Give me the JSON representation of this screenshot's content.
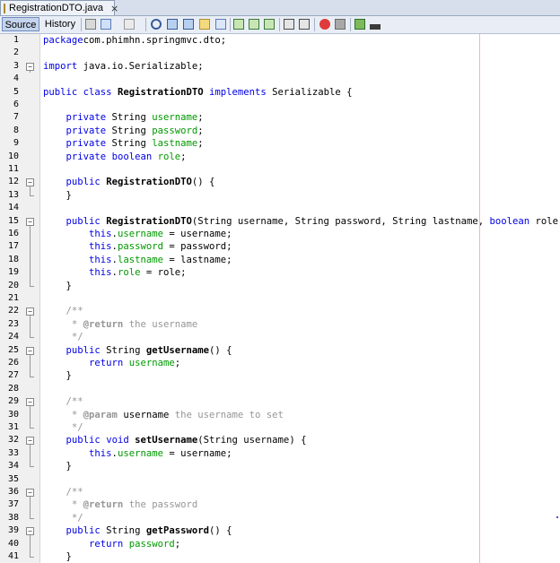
{
  "file_tab": {
    "name": "RegistrationDTO.java",
    "close": "×"
  },
  "toolbar": {
    "source_label": "Source",
    "history_label": "History"
  },
  "colors": {
    "keyword": "#0000e6",
    "field": "#009900",
    "comment": "#969696",
    "margin_line": "#f5b3c8"
  },
  "lines": [
    {
      "n": "1",
      "tokens": [
        [
          "kw",
          "package"
        ],
        [
          "",
          "com.phimhn.springmvc.dto;"
        ]
      ]
    },
    {
      "n": "2",
      "tokens": []
    },
    {
      "n": "3",
      "fold": "minus",
      "tokens": [
        [
          "kw",
          "import"
        ],
        [
          "",
          " java.io.Serializable;"
        ]
      ]
    },
    {
      "n": "4",
      "tokens": []
    },
    {
      "n": "5",
      "tokens": [
        [
          "kw",
          "public"
        ],
        [
          "",
          " "
        ],
        [
          "kw",
          "class"
        ],
        [
          "",
          " "
        ],
        [
          "bold",
          "RegistrationDTO"
        ],
        [
          "",
          " "
        ],
        [
          "kw",
          "implements"
        ],
        [
          "",
          " Serializable {"
        ]
      ]
    },
    {
      "n": "6",
      "tokens": []
    },
    {
      "n": "7",
      "tokens": [
        [
          "",
          "    "
        ],
        [
          "kw",
          "private"
        ],
        [
          "",
          " String "
        ],
        [
          "fld",
          "username"
        ],
        [
          "",
          ";"
        ]
      ]
    },
    {
      "n": "8",
      "tokens": [
        [
          "",
          "    "
        ],
        [
          "kw",
          "private"
        ],
        [
          "",
          " String "
        ],
        [
          "fld",
          "password"
        ],
        [
          "",
          ";"
        ]
      ]
    },
    {
      "n": "9",
      "tokens": [
        [
          "",
          "    "
        ],
        [
          "kw",
          "private"
        ],
        [
          "",
          " String "
        ],
        [
          "fld",
          "lastname"
        ],
        [
          "",
          ";"
        ]
      ]
    },
    {
      "n": "10",
      "tokens": [
        [
          "",
          "    "
        ],
        [
          "kw",
          "private"
        ],
        [
          "",
          " "
        ],
        [
          "kw",
          "boolean"
        ],
        [
          "",
          " "
        ],
        [
          "fld",
          "role"
        ],
        [
          "",
          ";"
        ]
      ]
    },
    {
      "n": "11",
      "tokens": []
    },
    {
      "n": "12",
      "fold": "minus",
      "tokens": [
        [
          "",
          "    "
        ],
        [
          "kw",
          "public"
        ],
        [
          "",
          " "
        ],
        [
          "bold",
          "RegistrationDTO"
        ],
        [
          "",
          "() {"
        ]
      ]
    },
    {
      "n": "13",
      "fold": "end",
      "tokens": [
        [
          "",
          "    }"
        ]
      ]
    },
    {
      "n": "14",
      "tokens": []
    },
    {
      "n": "15",
      "fold": "minus",
      "tokens": [
        [
          "",
          "    "
        ],
        [
          "kw",
          "public"
        ],
        [
          "",
          " "
        ],
        [
          "bold",
          "RegistrationDTO"
        ],
        [
          "",
          "(String username, String password, String lastname, "
        ],
        [
          "kw",
          "boolean"
        ],
        [
          "",
          " role) {"
        ]
      ]
    },
    {
      "n": "16",
      "fold": "line",
      "tokens": [
        [
          "",
          "        "
        ],
        [
          "kw",
          "this"
        ],
        [
          "",
          "."
        ],
        [
          "fld",
          "username"
        ],
        [
          "",
          " = username;"
        ]
      ]
    },
    {
      "n": "17",
      "fold": "line",
      "tokens": [
        [
          "",
          "        "
        ],
        [
          "kw",
          "this"
        ],
        [
          "",
          "."
        ],
        [
          "fld",
          "password"
        ],
        [
          "",
          " = password;"
        ]
      ]
    },
    {
      "n": "18",
      "fold": "line",
      "tokens": [
        [
          "",
          "        "
        ],
        [
          "kw",
          "this"
        ],
        [
          "",
          "."
        ],
        [
          "fld",
          "lastname"
        ],
        [
          "",
          " = lastname;"
        ]
      ]
    },
    {
      "n": "19",
      "fold": "line",
      "tokens": [
        [
          "",
          "        "
        ],
        [
          "kw",
          "this"
        ],
        [
          "",
          "."
        ],
        [
          "fld",
          "role"
        ],
        [
          "",
          " = role;"
        ]
      ]
    },
    {
      "n": "20",
      "fold": "end",
      "tokens": [
        [
          "",
          "    }"
        ]
      ]
    },
    {
      "n": "21",
      "tokens": []
    },
    {
      "n": "22",
      "fold": "minus",
      "tokens": [
        [
          "",
          "    "
        ],
        [
          "cm",
          "/**"
        ]
      ]
    },
    {
      "n": "23",
      "fold": "line",
      "tokens": [
        [
          "",
          "     "
        ],
        [
          "cm",
          "* "
        ],
        [
          "cmb",
          "@return"
        ],
        [
          "cm",
          " the username"
        ]
      ]
    },
    {
      "n": "24",
      "fold": "end",
      "tokens": [
        [
          "",
          "     "
        ],
        [
          "cm",
          "*/"
        ]
      ]
    },
    {
      "n": "25",
      "fold": "minus",
      "tokens": [
        [
          "",
          "    "
        ],
        [
          "kw",
          "public"
        ],
        [
          "",
          " String "
        ],
        [
          "bold",
          "getUsername"
        ],
        [
          "",
          "() {"
        ]
      ]
    },
    {
      "n": "26",
      "fold": "line",
      "tokens": [
        [
          "",
          "        "
        ],
        [
          "kw",
          "return"
        ],
        [
          "",
          " "
        ],
        [
          "fld",
          "username"
        ],
        [
          "",
          ";"
        ]
      ]
    },
    {
      "n": "27",
      "fold": "end",
      "tokens": [
        [
          "",
          "    }"
        ]
      ]
    },
    {
      "n": "28",
      "tokens": []
    },
    {
      "n": "29",
      "fold": "minus",
      "tokens": [
        [
          "",
          "    "
        ],
        [
          "cm",
          "/**"
        ]
      ]
    },
    {
      "n": "30",
      "fold": "line",
      "tokens": [
        [
          "",
          "     "
        ],
        [
          "cm",
          "* "
        ],
        [
          "cmb",
          "@param"
        ],
        [
          "",
          " username"
        ],
        [
          "cm",
          " the username to set"
        ]
      ]
    },
    {
      "n": "31",
      "fold": "end",
      "tokens": [
        [
          "",
          "     "
        ],
        [
          "cm",
          "*/"
        ]
      ]
    },
    {
      "n": "32",
      "fold": "minus",
      "tokens": [
        [
          "",
          "    "
        ],
        [
          "kw",
          "public"
        ],
        [
          "",
          " "
        ],
        [
          "kw",
          "void"
        ],
        [
          "",
          " "
        ],
        [
          "bold",
          "setUsername"
        ],
        [
          "",
          "(String username) {"
        ]
      ]
    },
    {
      "n": "33",
      "fold": "line",
      "tokens": [
        [
          "",
          "        "
        ],
        [
          "kw",
          "this"
        ],
        [
          "",
          "."
        ],
        [
          "fld",
          "username"
        ],
        [
          "",
          " = username;"
        ]
      ]
    },
    {
      "n": "34",
      "fold": "end",
      "tokens": [
        [
          "",
          "    }"
        ]
      ]
    },
    {
      "n": "35",
      "tokens": []
    },
    {
      "n": "36",
      "fold": "minus",
      "tokens": [
        [
          "",
          "    "
        ],
        [
          "cm",
          "/**"
        ]
      ]
    },
    {
      "n": "37",
      "fold": "line",
      "tokens": [
        [
          "",
          "     "
        ],
        [
          "cm",
          "* "
        ],
        [
          "cmb",
          "@return"
        ],
        [
          "cm",
          " the password"
        ]
      ]
    },
    {
      "n": "38",
      "fold": "end",
      "tokens": [
        [
          "",
          "     "
        ],
        [
          "cm",
          "*/"
        ]
      ]
    },
    {
      "n": "39",
      "fold": "minus",
      "tokens": [
        [
          "",
          "    "
        ],
        [
          "kw",
          "public"
        ],
        [
          "",
          " String "
        ],
        [
          "bold",
          "getPassword"
        ],
        [
          "",
          "() {"
        ]
      ]
    },
    {
      "n": "40",
      "fold": "line",
      "tokens": [
        [
          "",
          "        "
        ],
        [
          "kw",
          "return"
        ],
        [
          "",
          " "
        ],
        [
          "fld",
          "password"
        ],
        [
          "",
          ";"
        ]
      ]
    },
    {
      "n": "41",
      "fold": "end",
      "tokens": [
        [
          "",
          "    }"
        ]
      ]
    }
  ]
}
